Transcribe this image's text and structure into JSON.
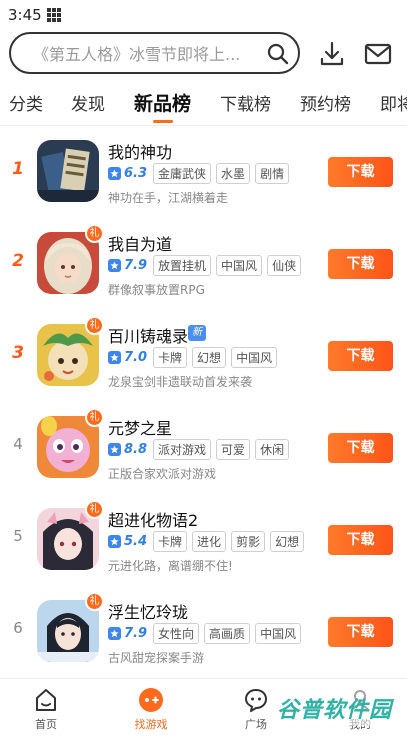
{
  "status_bar": {
    "time": "3:45"
  },
  "search": {
    "placeholder": "《第五人格》冰雪节即将上..."
  },
  "tabs": [
    {
      "label": "分类",
      "active": false
    },
    {
      "label": "发现",
      "active": false
    },
    {
      "label": "新品榜",
      "active": true
    },
    {
      "label": "下载榜",
      "active": false
    },
    {
      "label": "预约榜",
      "active": false
    },
    {
      "label": "即将",
      "active": false
    }
  ],
  "colors": {
    "accent": "#ff6a1c",
    "rating_blue": "#2f7fe8",
    "new_badge": "#4a8ff0"
  },
  "games": [
    {
      "rank": "1",
      "name": "我的神功",
      "rating": "6.3",
      "tags": [
        "金庸武侠",
        "水墨",
        "剧情"
      ],
      "desc": "神功在手，江湖横着走",
      "gift": false,
      "new_badge": "",
      "button": "下载"
    },
    {
      "rank": "2",
      "name": "我自为道",
      "rating": "7.9",
      "tags": [
        "放置挂机",
        "中国风",
        "仙侠"
      ],
      "desc": "群像叙事放置RPG",
      "gift": true,
      "new_badge": "",
      "button": "下载"
    },
    {
      "rank": "3",
      "name": "百川铸魂录",
      "rating": "7.0",
      "tags": [
        "卡牌",
        "幻想",
        "中国风"
      ],
      "desc": "龙泉宝剑非遗联动首发来袭",
      "gift": true,
      "new_badge": "新",
      "button": "下载"
    },
    {
      "rank": "4",
      "name": "元梦之星",
      "rating": "8.8",
      "tags": [
        "派对游戏",
        "可爱",
        "休闲"
      ],
      "desc": "正版合家欢派对游戏",
      "gift": true,
      "new_badge": "",
      "button": "下载"
    },
    {
      "rank": "5",
      "name": "超进化物语2",
      "rating": "5.4",
      "tags": [
        "卡牌",
        "进化",
        "剪影",
        "幻想"
      ],
      "desc": "元进化路，离谱绷不住!",
      "gift": true,
      "new_badge": "",
      "button": "下载"
    },
    {
      "rank": "6",
      "name": "浮生忆玲珑",
      "rating": "7.9",
      "tags": [
        "女性向",
        "高画质",
        "中国风"
      ],
      "desc": "古风甜宠探案手游",
      "gift": true,
      "new_badge": "",
      "button": "下载"
    }
  ],
  "bottom_nav": [
    {
      "label": "首页",
      "icon": "home-icon",
      "active": false
    },
    {
      "label": "找游戏",
      "icon": "game-controller-icon",
      "active": true
    },
    {
      "label": "广场",
      "icon": "chat-bubble-icon",
      "active": false
    },
    {
      "label": "我的",
      "icon": "profile-icon",
      "active": false
    }
  ],
  "watermark": {
    "text": "谷普软件园"
  }
}
